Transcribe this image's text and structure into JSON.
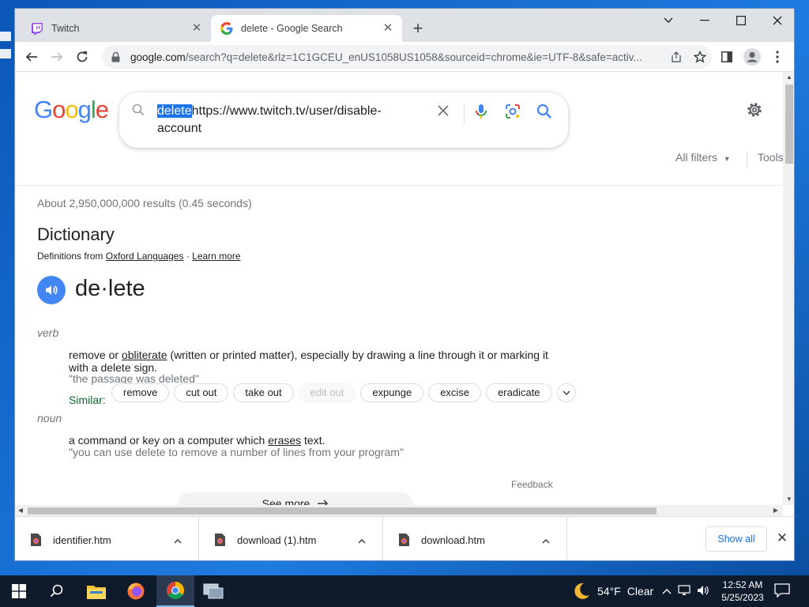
{
  "browser": {
    "tabs": [
      {
        "title": "Twitch",
        "favicon": "twitch-icon"
      },
      {
        "title": "delete - Google Search",
        "favicon": "google-icon"
      }
    ],
    "address": {
      "host": "google.com",
      "rest": "/search?q=delete&rlz=1C1GCEU_enUS1058US1058&sourceid=chrome&ie=UTF-8&safe=activ..."
    }
  },
  "search": {
    "logo": "Google",
    "query_selected": "delete",
    "query_rest": "https://www.twitch.tv/user/disable-account",
    "all_filters": "All filters",
    "tools": "Tools",
    "stats": "About 2,950,000,000 results (0.45 seconds)"
  },
  "dictionary": {
    "title": "Dictionary",
    "source_prefix": "Definitions from",
    "source_link": "Oxford Languages",
    "separator": " · ",
    "learn_more": "Learn more",
    "headword": "de·lete",
    "verb": {
      "pos": "verb",
      "def_a": "remove or ",
      "def_link": "obliterate",
      "def_b": " (written or printed matter), especially by drawing a line through it or marking it with a delete sign.",
      "example": "\"the passage was deleted\"",
      "similar_label": "Similar:",
      "similar": [
        "remove",
        "cut out",
        "take out",
        "edit out",
        "expunge",
        "excise",
        "eradicate"
      ]
    },
    "noun": {
      "pos": "noun",
      "def_a": "a command or key on a computer which ",
      "def_link": "erases",
      "def_b": " text.",
      "example": "\"you can use delete to remove a number of lines from your program\""
    },
    "feedback": "Feedback",
    "see_more": "See more"
  },
  "downloads": {
    "items": [
      "identifier.htm",
      "download (1).htm",
      "download.htm"
    ],
    "show_all": "Show all"
  },
  "taskbar": {
    "temp": "54°F",
    "condition": "Clear",
    "time": "12:52 AM",
    "date": "5/25/2023"
  },
  "colors": {
    "google_blue": "#4285f4",
    "google_red": "#ea4335",
    "google_yellow": "#fbbc05",
    "google_green": "#34a853",
    "selection": "#1a73e8",
    "twitch_purple": "#9146ff"
  }
}
